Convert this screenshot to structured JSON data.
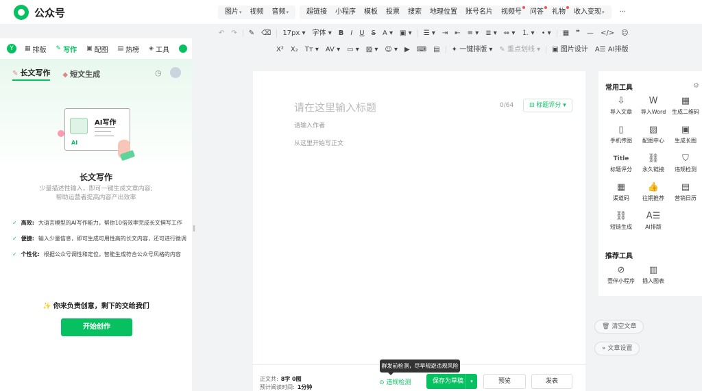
{
  "app": {
    "title": "公众号"
  },
  "topnav": {
    "group1": [
      {
        "label": "图片",
        "caret": true
      },
      {
        "label": "视频",
        "caret": false
      },
      {
        "label": "音频",
        "caret": true
      }
    ],
    "group2": [
      {
        "label": "超链接",
        "dot": false,
        "caret": false
      },
      {
        "label": "小程序",
        "dot": false,
        "caret": false
      },
      {
        "label": "模板",
        "dot": false,
        "caret": false
      },
      {
        "label": "投票",
        "dot": false,
        "caret": false
      },
      {
        "label": "搜索",
        "dot": false,
        "caret": false
      },
      {
        "label": "地理位置",
        "dot": false,
        "caret": false
      },
      {
        "label": "账号名片",
        "dot": false,
        "caret": false
      },
      {
        "label": "视频号",
        "dot": true,
        "caret": false
      },
      {
        "label": "问答",
        "dot": true,
        "caret": false
      },
      {
        "label": "礼物",
        "dot": true,
        "caret": false
      },
      {
        "label": "收入变现",
        "dot": false,
        "caret": true
      }
    ],
    "more": "···"
  },
  "toolbar": {
    "font_size": "17px",
    "font_family": "字体",
    "one_click_layout": "一键排版",
    "highlight": "重点划线",
    "image_design": "图片设计",
    "ai_layout": "AI排版"
  },
  "left_panel": {
    "logo": "Y",
    "tabs": [
      {
        "label": "排版",
        "icon": "layout-icon"
      },
      {
        "label": "写作",
        "icon": "ai-write-icon"
      },
      {
        "label": "配图",
        "icon": "image-icon"
      },
      {
        "label": "热榜",
        "icon": "hot-list-icon"
      },
      {
        "label": "工具",
        "icon": "tools-icon"
      }
    ],
    "subtabs": {
      "long": "长文写作",
      "short": "短文生成"
    },
    "illustration": {
      "label": "AI写作",
      "mini": "AI"
    },
    "title": "长文写作",
    "desc_line1": "少量描述性输入，即可一键生成文章内容;",
    "desc_line2": "帮助运营者提高内容产出效率",
    "features": [
      {
        "key": "高效:",
        "text": "大语言模型的AI写作能力，帮你10倍效率完成长文撰写工作"
      },
      {
        "key": "便捷:",
        "text": "输入少量信息，即可生成可用性高的长文内容，还可进行微调"
      },
      {
        "key": "个性化:",
        "text": "根据公众号调性和定位，智能生成符合公众号风格的内容"
      }
    ],
    "slogan": "你来负责创意，剩下的交给我们",
    "start_button": "开始创作"
  },
  "editor": {
    "title_placeholder": "请在这里输入标题",
    "title_count": "0/64",
    "title_score": "标题评分",
    "author_placeholder": "请输入作者",
    "body_placeholder": "从这里开始写正文",
    "stats": {
      "words_label": "正文共:",
      "words_value": "8字 0图",
      "read_label": "预计阅读时间:",
      "read_value": "1分钟"
    },
    "violation_check": "违规检测",
    "tooltip": "群发前检测，尽早规避违规风险",
    "save_button": "保存为草稿",
    "preview_button": "预览",
    "publish_button": "发表"
  },
  "right_panel": {
    "common_title": "常用工具",
    "common_tools": [
      {
        "label": "导入文章",
        "icon": "import-article-icon"
      },
      {
        "label": "导入Word",
        "icon": "import-word-icon"
      },
      {
        "label": "生成二维码",
        "icon": "qrcode-icon"
      },
      {
        "label": "手机传图",
        "icon": "phone-upload-icon"
      },
      {
        "label": "配图中心",
        "icon": "image-center-icon"
      },
      {
        "label": "生成长图",
        "icon": "long-image-icon"
      },
      {
        "label": "标题评分",
        "icon": "title-score-icon"
      },
      {
        "label": "永久链接",
        "icon": "link-icon"
      },
      {
        "label": "违规检测",
        "icon": "shield-icon"
      },
      {
        "label": "渠道码",
        "icon": "channel-code-icon"
      },
      {
        "label": "往期推荐",
        "icon": "thumbs-up-icon"
      },
      {
        "label": "营销日历",
        "icon": "calendar-icon"
      },
      {
        "label": "短链生成",
        "icon": "short-link-icon"
      },
      {
        "label": "AI排版",
        "icon": "ai-layout-icon"
      }
    ],
    "recommended_title": "推荐工具",
    "recommended_tools": [
      {
        "label": "壹伴小程序",
        "icon": "mini-program-icon"
      },
      {
        "label": "插入图表",
        "icon": "chart-icon"
      }
    ],
    "clear_article": "清空文章",
    "article_settings": "文章设置"
  }
}
